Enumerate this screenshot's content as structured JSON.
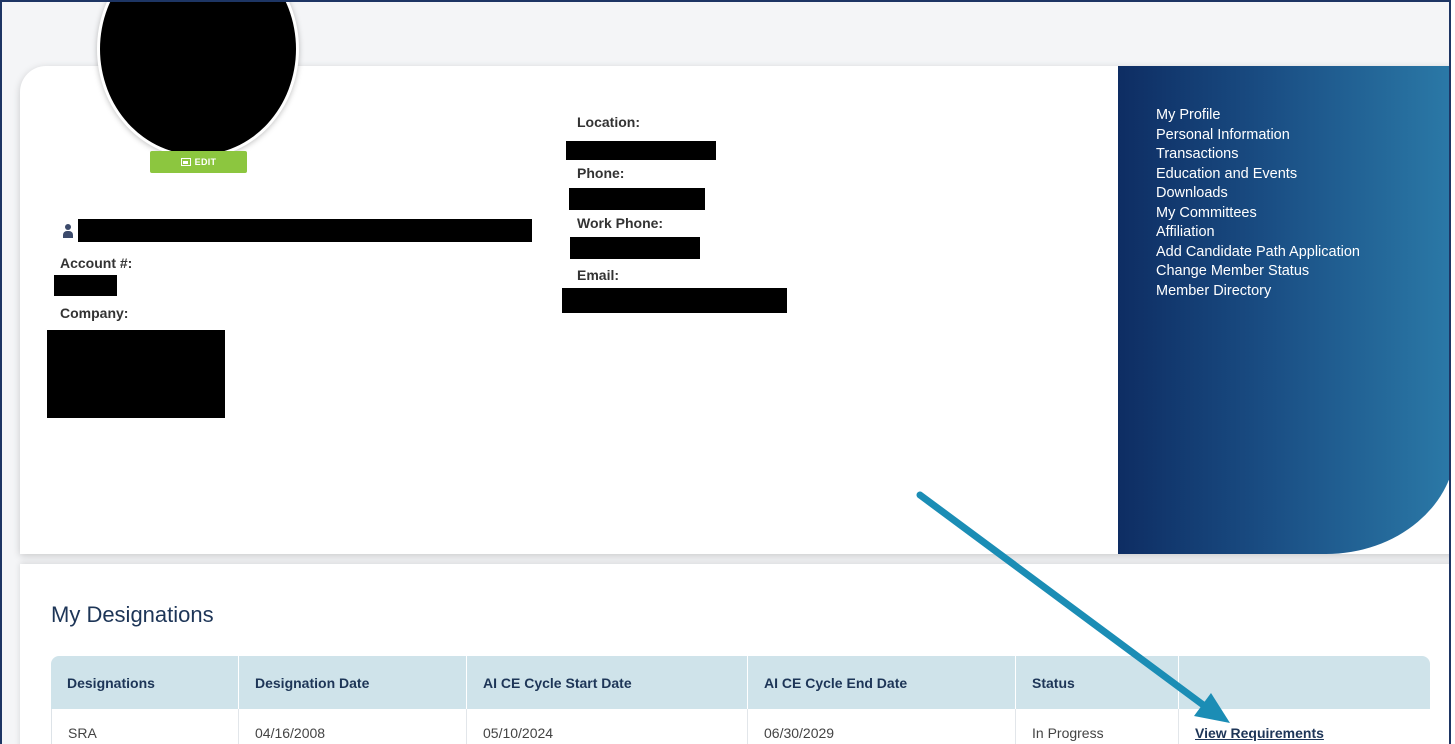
{
  "profile": {
    "edit_label": "EDIT",
    "account_label": "Account #:",
    "company_label": "Company:",
    "location_label": "Location:",
    "phone_label": "Phone:",
    "work_phone_label": "Work Phone:",
    "email_label": "Email:"
  },
  "nav": {
    "items": [
      "My Profile",
      "Personal Information",
      "Transactions",
      "Education and Events",
      "Downloads",
      "My Committees",
      "Affiliation",
      "Add Candidate Path Application",
      "Change Member Status",
      "Member Directory"
    ]
  },
  "designations": {
    "title": "My Designations",
    "columns": [
      "Designations",
      "Designation Date",
      "AI CE Cycle Start Date",
      "AI CE Cycle End Date",
      "Status",
      ""
    ],
    "rows": [
      [
        "SRA",
        "04/16/2008",
        "05/10/2024",
        "06/30/2029",
        "In Progress",
        "View Requirements"
      ]
    ]
  },
  "colors": {
    "nav_gradient_start": "#0e2d63",
    "nav_gradient_end": "#2b7aa8",
    "edit_button": "#8cc63f",
    "table_header": "#cfe3ea",
    "annotation_arrow": "#1b8db5"
  },
  "icons": [
    "picture-icon",
    "user-icon",
    "arrow-annotation"
  ]
}
